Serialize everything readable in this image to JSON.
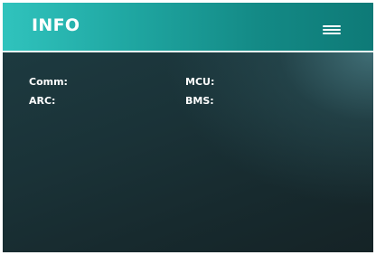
{
  "header": {
    "title": "INFO",
    "menu_icon": "hamburger-menu-icon"
  },
  "info": {
    "comm": {
      "label": "Comm:",
      "value": ""
    },
    "mcu": {
      "label": "MCU:",
      "value": ""
    },
    "arc": {
      "label": "ARC:",
      "value": ""
    },
    "bms": {
      "label": "BMS:",
      "value": ""
    }
  },
  "colors": {
    "header_accent": "#1fa6a1",
    "header_divider": "#e9f6f5",
    "panel_background": "#16282c",
    "text": "#ffffff"
  }
}
